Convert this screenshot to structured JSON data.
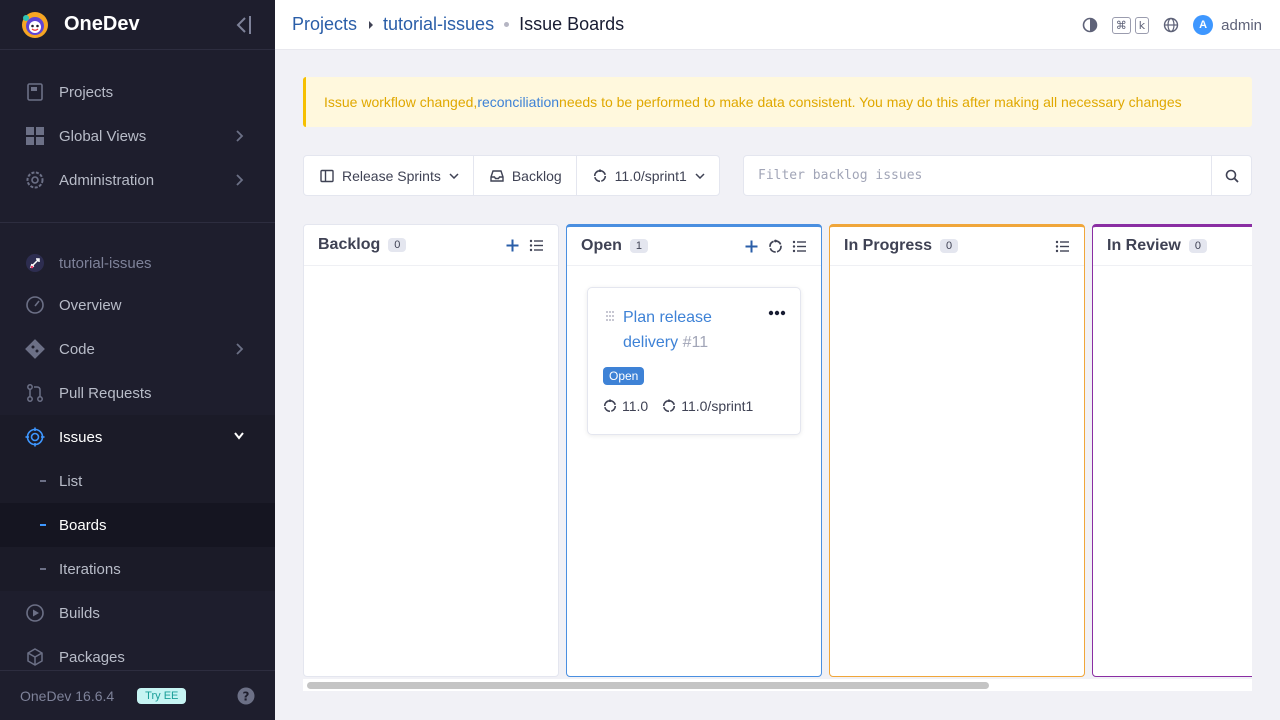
{
  "app": {
    "name": "OneDev",
    "version": "OneDev 16.6.4",
    "try_ee": "Try EE"
  },
  "sidebar": {
    "items": [
      {
        "label": "Projects",
        "icon": "book-icon"
      },
      {
        "label": "Global Views",
        "icon": "grid-icon"
      },
      {
        "label": "Administration",
        "icon": "gear-icon"
      }
    ],
    "project": "tutorial-issues",
    "project_items": [
      {
        "label": "Overview",
        "icon": "gauge-icon"
      },
      {
        "label": "Code",
        "icon": "git-icon"
      },
      {
        "label": "Pull Requests",
        "icon": "pull-request-icon"
      },
      {
        "label": "Issues",
        "icon": "target-icon"
      },
      {
        "label": "Builds",
        "icon": "play-icon"
      },
      {
        "label": "Packages",
        "icon": "box-icon"
      }
    ],
    "issue_subitems": [
      {
        "label": "List"
      },
      {
        "label": "Boards"
      },
      {
        "label": "Iterations"
      }
    ]
  },
  "header": {
    "breadcrumb": [
      "Projects",
      "tutorial-issues",
      "Issue Boards"
    ],
    "kbd_keys": [
      "⌘",
      "k"
    ],
    "user_initial": "A",
    "user_name": "admin"
  },
  "alert": {
    "prefix": "Issue workflow changed, ",
    "link": "reconciliation",
    "suffix": " needs to be performed to make data consistent. You may do this after making all necessary changes"
  },
  "toolbar": {
    "board": "Release Sprints",
    "backlog": "Backlog",
    "iteration": "11.0/sprint1",
    "filter_placeholder": "Filter backlog issues"
  },
  "columns": [
    {
      "title": "Backlog",
      "count": "0"
    },
    {
      "title": "Open",
      "count": "1"
    },
    {
      "title": "In Progress",
      "count": "0"
    },
    {
      "title": "In Review",
      "count": "0"
    }
  ],
  "card": {
    "title": "Plan release delivery",
    "number": "#11",
    "state": "Open",
    "milestone": "11.0",
    "iteration": "11.0/sprint1"
  },
  "colors": {
    "sidebar_bg": "#1e1e2d",
    "accent": "#3e82d6",
    "open_border": "#4a8fe0",
    "in_progress_border": "#f0a63a",
    "in_review_border": "#8a2ea3",
    "alert_text": "#e0a800"
  }
}
